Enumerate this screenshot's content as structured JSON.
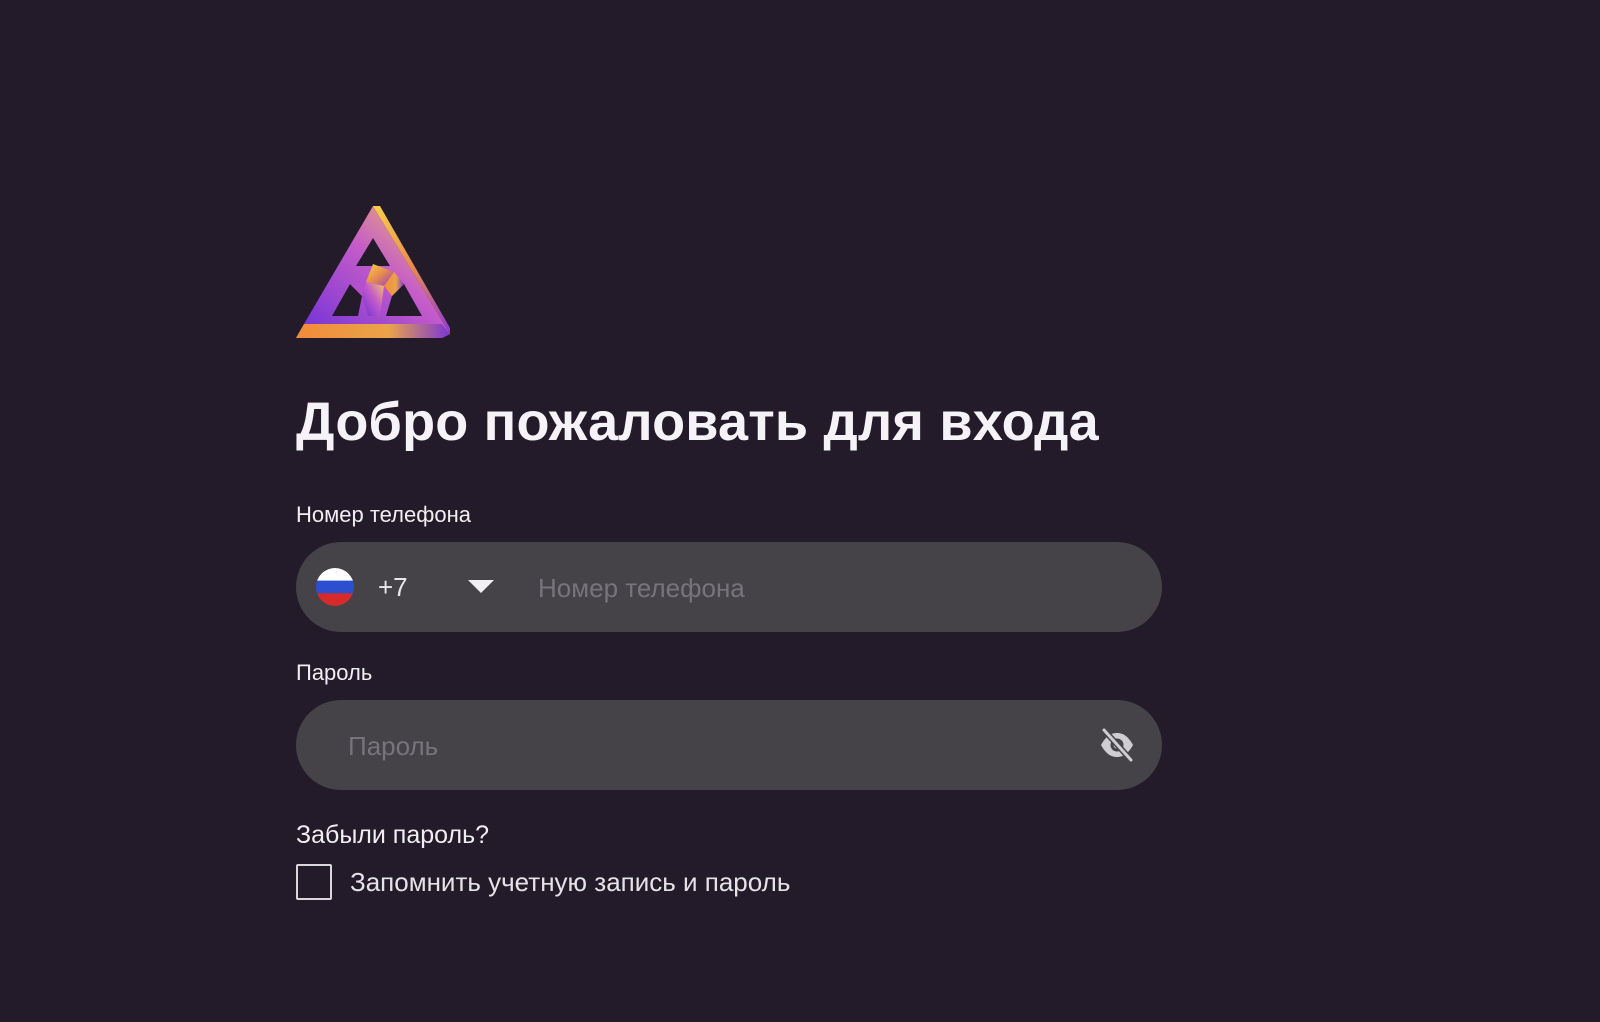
{
  "login": {
    "title": "Добро пожаловать для входа",
    "phone": {
      "label": "Номер телефона",
      "country_code": "+7",
      "placeholder": "Номер телефона",
      "flag": "russia-flag-icon"
    },
    "password": {
      "label": "Пароль",
      "placeholder": "Пароль",
      "toggle_icon": "eye-off-icon"
    },
    "forgot_password": "Забыли пароль?",
    "remember_me": {
      "label": "Запомнить учетную запись и пароль",
      "checked": false
    }
  },
  "colors": {
    "background": "#231b2a",
    "field_background": "#454347",
    "text": "#f4f1f6",
    "placeholder": "#77747b",
    "logo_purple": "#7b35d6",
    "logo_orange": "#f39a3a",
    "logo_yellow": "#f8d24a"
  }
}
